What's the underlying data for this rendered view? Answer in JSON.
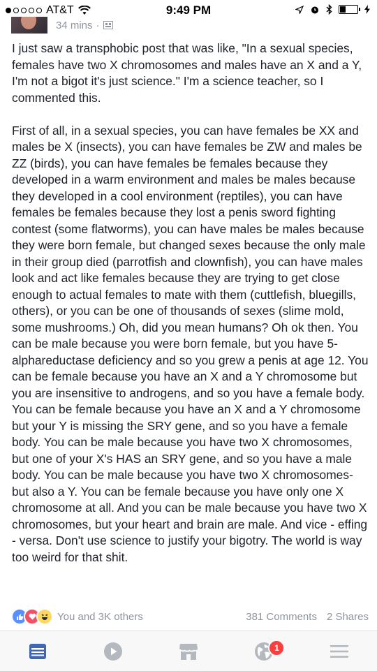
{
  "status_bar": {
    "carrier": "AT&T",
    "time": "9:49 PM"
  },
  "post": {
    "time_ago": "34 mins",
    "separator": "·",
    "paragraphs": [
      "I just saw a transphobic post that was like, \"In a sexual species, females have two X chromosomes and males have an X and a Y, I'm not a bigot it's just science.\" I'm a science teacher, so I commented this.",
      "First of all, in a sexual species, you can have females be XX and males be X (insects), you can have females be ZW and males be ZZ (birds), you can have females be females because they developed in a warm environment and males be males because they developed in a cool environment (reptiles), you can have females be females because they lost a penis sword fighting contest (some flatworms), you can have males be males because they were born female, but changed sexes because the only male in their group died (parrotfish and clownfish), you can have males look and act like females because they are trying to get close enough to actual females to mate with them (cuttlefish, bluegills, others), or you can be one of thousands of sexes (slime mold, some mushrooms.) Oh, did you mean humans? Oh ok then. You can be male because you were born female, but you have 5-alphareductase deficiency and so you grew a penis at age 12. You can be female because you have an X and a Y chromosome but you are insensitive to androgens, and so you have a female body. You can be female because you have an X and a Y chromosome but your Y is missing the SRY gene, and so you have a female body. You can be male because you have two X chromosomes, but one of your X's HAS an SRY gene, and so you have a male body. You can be male because you have two X chromosomes- but also a Y. You can be female because you have only one X chromosome at all. And you can be male because you have two X chromosomes, but your heart and brain are male. And vice - effing - versa. Don't use science to justify your bigotry. The world is way too weird for that shit."
    ]
  },
  "reactions": {
    "summary": "You and 3K others",
    "comments": "381 Comments",
    "shares": "2 Shares",
    "icons": [
      "like-icon",
      "love-icon",
      "haha-icon"
    ]
  },
  "tabbar": {
    "tabs": [
      "news-feed-icon",
      "video-icon",
      "marketplace-icon",
      "notifications-globe-icon",
      "menu-icon"
    ],
    "notifications_badge": "1",
    "active_color": "#4267b2",
    "inactive_color": "#b4b8bf"
  }
}
